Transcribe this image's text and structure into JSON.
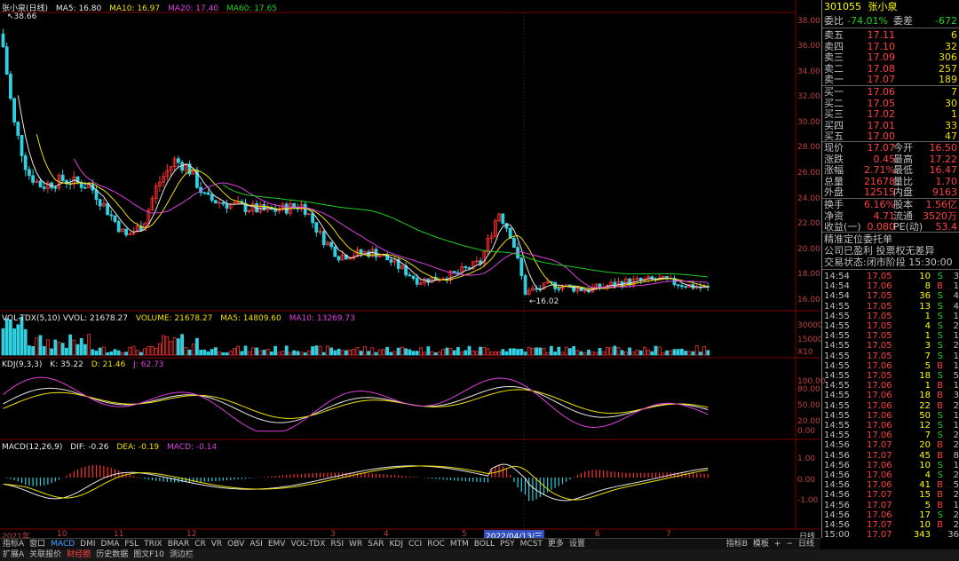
{
  "header": {
    "stock_name": "张小泉(日线)",
    "ma5": "MA5: 16.80",
    "ma10": "MA10: 16.97",
    "ma20": "MA20: 17.40",
    "ma60": "MA60: 17.65",
    "high_mark": "38.66",
    "low_mark": "16.02"
  },
  "price_axis": [
    "38.00",
    "36.00",
    "34.00",
    "32.00",
    "30.00",
    "28.00",
    "26.00",
    "24.00",
    "22.00",
    "20.00",
    "18.00",
    "16.00"
  ],
  "vol": {
    "title": "VOL-TDX(5,10) VVOL: 21678.27",
    "volume": "VOLUME: 21678.27",
    "ma5": "MA5: 14809.60",
    "ma10": "MA10: 13269.73",
    "axis": [
      "30000",
      "15000",
      "X10"
    ]
  },
  "kdj": {
    "title": "KDJ(9,3,3)",
    "k": "K: 35.22",
    "d": "D: 21.46",
    "j": "J: 62.73",
    "axis": [
      "100.00",
      "80.00",
      "50.00",
      "20.00",
      "0.00"
    ]
  },
  "macd": {
    "title": "MACD(12,26,9)",
    "dif": "DIF: -0.26",
    "dea": "DEA: -0.19",
    "macd": "MACD: -0.14",
    "axis": [
      "1.00",
      "0.00",
      "-1.00"
    ]
  },
  "x_axis": {
    "year": "2021年",
    "highlight": "2022/04/13/三",
    "labels": [
      "10",
      "11",
      "12",
      "3",
      "4",
      "5",
      "6",
      "7"
    ],
    "right": "日线"
  },
  "quote": {
    "code": "301055",
    "name": "张小泉",
    "weibi_label": "委比",
    "weibi": "-74.01%",
    "weicha_label": "委差",
    "weicha": "-672",
    "asks": [
      {
        "label": "卖五",
        "price": "17.11",
        "vol": "6"
      },
      {
        "label": "卖四",
        "price": "17.10",
        "vol": "32"
      },
      {
        "label": "卖三",
        "price": "17.09",
        "vol": "306"
      },
      {
        "label": "卖二",
        "price": "17.08",
        "vol": "257"
      },
      {
        "label": "卖一",
        "price": "17.07",
        "vol": "189"
      }
    ],
    "bids": [
      {
        "label": "买一",
        "price": "17.06",
        "vol": "7"
      },
      {
        "label": "买二",
        "price": "17.05",
        "vol": "30"
      },
      {
        "label": "买三",
        "price": "17.02",
        "vol": "1"
      },
      {
        "label": "买四",
        "price": "17.01",
        "vol": "33"
      },
      {
        "label": "买五",
        "price": "17.00",
        "vol": "47"
      }
    ],
    "stats": [
      {
        "l1": "现价",
        "v1": "17.07",
        "l2": "今开",
        "v2": "16.50"
      },
      {
        "l1": "涨跌",
        "v1": "0.45",
        "l2": "最高",
        "v2": "17.22"
      },
      {
        "l1": "涨幅",
        "v1": "2.71%",
        "l2": "最低",
        "v2": "16.47"
      },
      {
        "l1": "总量",
        "v1": "21678",
        "l2": "量比",
        "v2": "1.70"
      },
      {
        "l1": "外盘",
        "v1": "12515",
        "l2": "内盘",
        "v2": "9163"
      }
    ],
    "stats2": [
      {
        "l1": "换手",
        "v1": "6.16%",
        "l2": "股本",
        "v2": "1.56亿"
      },
      {
        "l1": "净资",
        "v1": "4.71",
        "l2": "流通",
        "v2": "3520万"
      },
      {
        "l1": "收益(一)",
        "v1": "0.080",
        "l2": "PE(动)",
        "v2": "53.4"
      }
    ],
    "info1": "精准定位委托单",
    "info2": "公司已盈利 投票权无差异",
    "info3": "交易状态:闭市阶段 15:30:00"
  },
  "ticks": [
    {
      "t": "14:54",
      "p": "17.05",
      "v": "10",
      "d": "S",
      "n": "3"
    },
    {
      "t": "14:54",
      "p": "17.06",
      "v": "8",
      "d": "B",
      "n": "1"
    },
    {
      "t": "14:54",
      "p": "17.05",
      "v": "36",
      "d": "S",
      "n": "4"
    },
    {
      "t": "14:55",
      "p": "17.05",
      "v": "13",
      "d": "S",
      "n": "4"
    },
    {
      "t": "14:55",
      "p": "17.05",
      "v": "1",
      "d": "S",
      "n": "1"
    },
    {
      "t": "14:55",
      "p": "17.05",
      "v": "4",
      "d": "S",
      "n": "2"
    },
    {
      "t": "14:55",
      "p": "17.05",
      "v": "1",
      "d": "S",
      "n": "1"
    },
    {
      "t": "14:55",
      "p": "17.05",
      "v": "3",
      "d": "S",
      "n": "2"
    },
    {
      "t": "14:55",
      "p": "17.05",
      "v": "7",
      "d": "S",
      "n": "1"
    },
    {
      "t": "14:55",
      "p": "17.06",
      "v": "5",
      "d": "B",
      "n": "1"
    },
    {
      "t": "14:55",
      "p": "17.05",
      "v": "18",
      "d": "S",
      "n": "5"
    },
    {
      "t": "14:55",
      "p": "17.06",
      "v": "1",
      "d": "B",
      "n": "1"
    },
    {
      "t": "14:55",
      "p": "17.06",
      "v": "18",
      "d": "B",
      "n": "3"
    },
    {
      "t": "14:55",
      "p": "17.06",
      "v": "22",
      "d": "B",
      "n": "2"
    },
    {
      "t": "14:55",
      "p": "17.06",
      "v": "50",
      "d": "S",
      "n": "1"
    },
    {
      "t": "14:55",
      "p": "17.06",
      "v": "12",
      "d": "S",
      "n": "1"
    },
    {
      "t": "14:55",
      "p": "17.06",
      "v": "7",
      "d": "S",
      "n": "2"
    },
    {
      "t": "14:56",
      "p": "17.07",
      "v": "20",
      "d": "B",
      "n": "2"
    },
    {
      "t": "14:56",
      "p": "17.07",
      "v": "45",
      "d": "B",
      "n": "8"
    },
    {
      "t": "14:56",
      "p": "17.06",
      "v": "10",
      "d": "S",
      "n": "1"
    },
    {
      "t": "14:56",
      "p": "17.06",
      "v": "4",
      "d": "S",
      "n": "2"
    },
    {
      "t": "14:56",
      "p": "17.06",
      "v": "41",
      "d": "B",
      "n": "5"
    },
    {
      "t": "14:56",
      "p": "17.07",
      "v": "15",
      "d": "B",
      "n": "2"
    },
    {
      "t": "14:56",
      "p": "17.07",
      "v": "5",
      "d": "B",
      "n": "1"
    },
    {
      "t": "14:56",
      "p": "17.06",
      "v": "17",
      "d": "S",
      "n": "2"
    },
    {
      "t": "14:56",
      "p": "17.07",
      "v": "10",
      "d": "B",
      "n": "2"
    },
    {
      "t": "15:00",
      "p": "17.07",
      "v": "343",
      "d": "",
      "n": "36"
    }
  ],
  "tabs": [
    "指标A",
    "窗口",
    "MACD",
    "DMI",
    "DMA",
    "FSL",
    "TRIX",
    "BRAR",
    "CR",
    "VR",
    "OBV",
    "ASI",
    "EMV",
    "VOL-TDX",
    "RSI",
    "WR",
    "SAR",
    "KDJ",
    "CCI",
    "ROC",
    "MTM",
    "BOLL",
    "PSY",
    "MCST",
    "更多",
    "设置"
  ],
  "tabs_right": [
    "指标B",
    "模板",
    "+",
    "−",
    "日线"
  ],
  "status": [
    "扩展A",
    "关联报价",
    "财经圈",
    "历史数据",
    "图文F10",
    "测边栏"
  ]
}
